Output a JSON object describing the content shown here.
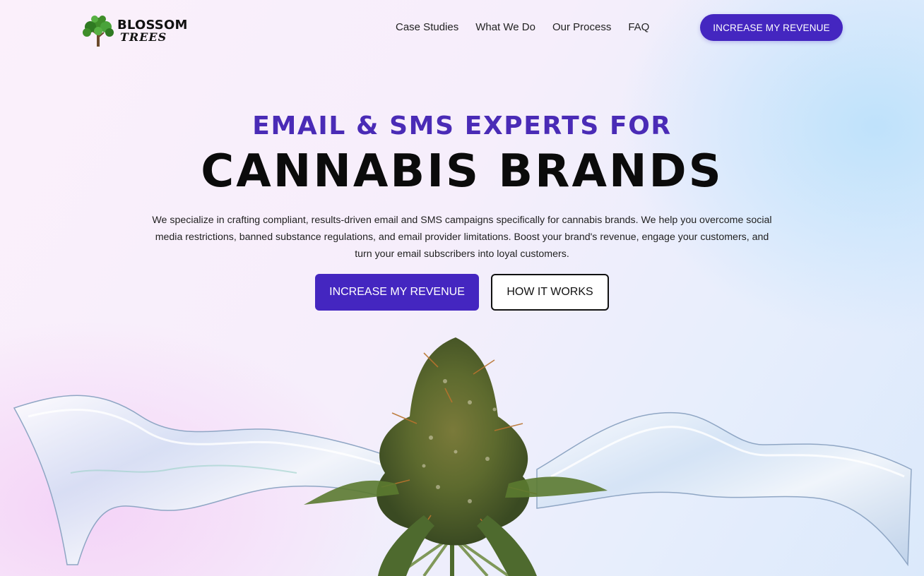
{
  "brand": {
    "name_line1": "BLOSSOM",
    "name_line2": "TREES"
  },
  "nav": {
    "items": [
      {
        "label": "Case Studies"
      },
      {
        "label": "What We Do"
      },
      {
        "label": "Our Process"
      },
      {
        "label": "FAQ"
      }
    ],
    "cta_label": "INCREASE MY REVENUE"
  },
  "hero": {
    "subtitle": "EMAIL & SMS EXPERTS FOR",
    "title": "CANNABIS BRANDS",
    "description": "We specialize in crafting compliant, results-driven email and SMS campaigns specifically for cannabis brands. We help you overcome social media restrictions, banned substance regulations, and email provider limitations. Boost your brand's revenue, engage your customers, and turn your email subscribers into loyal customers.",
    "primary_button": "INCREASE MY REVENUE",
    "secondary_button": "HOW IT WORKS"
  },
  "colors": {
    "accent": "#4426c0",
    "subtitle": "#4a2bb6",
    "title": "#0b0b0b"
  }
}
